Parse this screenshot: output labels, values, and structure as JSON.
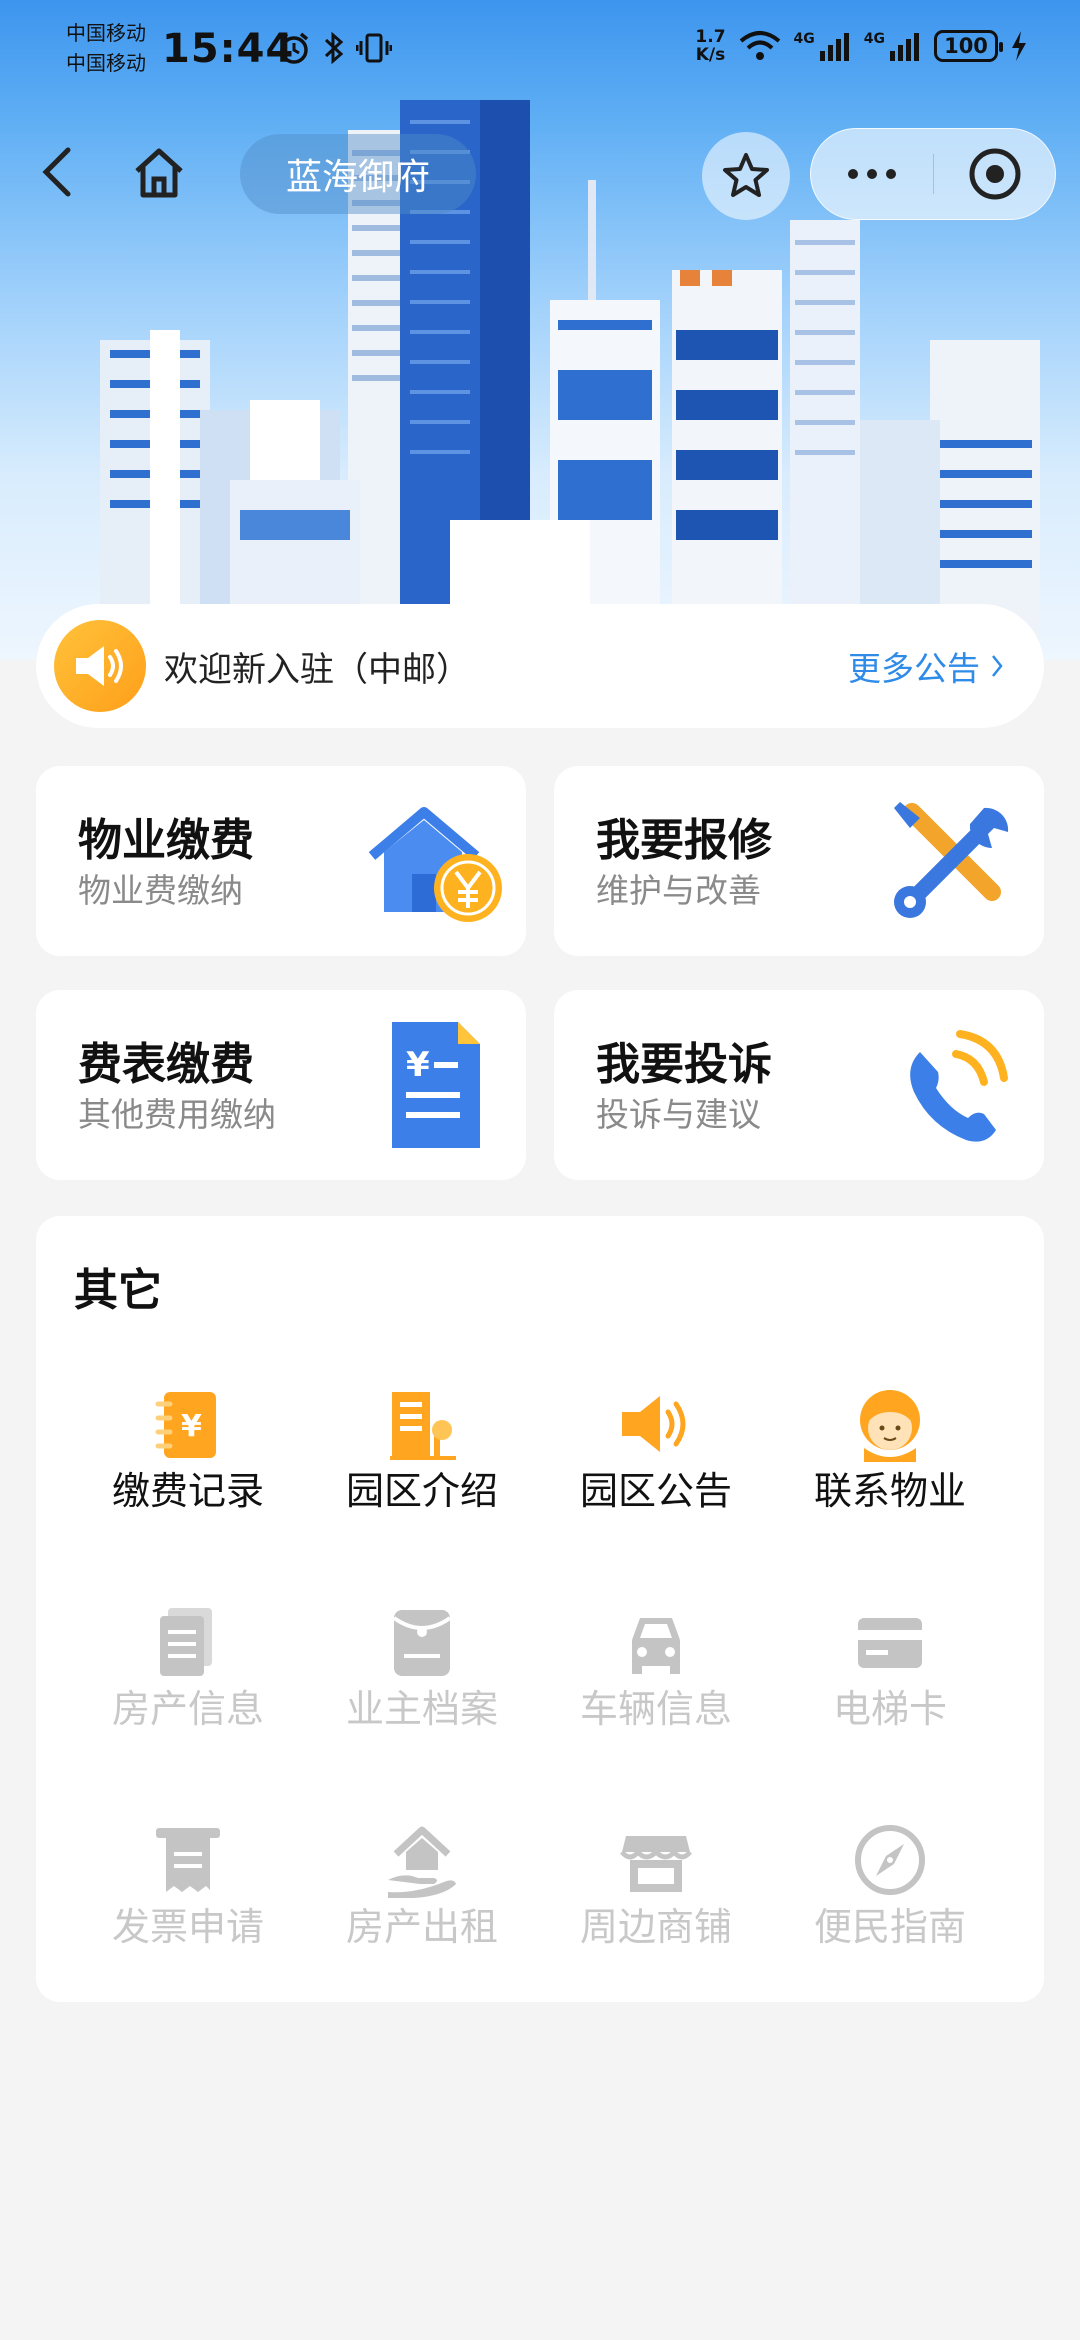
{
  "status_bar": {
    "carrier_1": "中国移动",
    "carrier_2": "中国移动",
    "time": "15:44",
    "net_speed_value": "1.7",
    "net_speed_unit": "K/s",
    "network_1": "4G",
    "network_2": "4G",
    "battery": "100"
  },
  "nav": {
    "title": "蓝海御府"
  },
  "notice": {
    "text": "欢迎新入驻（中邮）",
    "more_label": "更多公告"
  },
  "services": [
    {
      "title": "物业缴费",
      "subtitle": "物业费缴纳",
      "icon": "house-yen-icon"
    },
    {
      "title": "我要报修",
      "subtitle": "维护与改善",
      "icon": "tools-icon"
    },
    {
      "title": "费表缴费",
      "subtitle": "其他费用缴纳",
      "icon": "bill-document-icon"
    },
    {
      "title": "我要投诉",
      "subtitle": "投诉与建议",
      "icon": "phone-call-icon"
    }
  ],
  "others": {
    "title": "其它",
    "items": [
      {
        "label": "缴费记录",
        "icon": "payment-record-icon",
        "enabled": true
      },
      {
        "label": "园区介绍",
        "icon": "building-icon",
        "enabled": true
      },
      {
        "label": "园区公告",
        "icon": "speaker-icon",
        "enabled": true
      },
      {
        "label": "联系物业",
        "icon": "customer-service-icon",
        "enabled": true
      },
      {
        "label": "房产信息",
        "icon": "documents-icon",
        "enabled": false
      },
      {
        "label": "业主档案",
        "icon": "archive-icon",
        "enabled": false
      },
      {
        "label": "车辆信息",
        "icon": "car-icon",
        "enabled": false
      },
      {
        "label": "电梯卡",
        "icon": "card-icon",
        "enabled": false
      },
      {
        "label": "发票申请",
        "icon": "receipt-icon",
        "enabled": false
      },
      {
        "label": "房产出租",
        "icon": "house-hand-icon",
        "enabled": false
      },
      {
        "label": "周边商铺",
        "icon": "shop-icon",
        "enabled": false
      },
      {
        "label": "便民指南",
        "icon": "compass-icon",
        "enabled": false
      }
    ]
  },
  "colors": {
    "accent_orange": "#ffa51f",
    "accent_blue": "#2e8be8",
    "disabled_gray": "#c8c8c8",
    "background": "#f4f4f5"
  }
}
